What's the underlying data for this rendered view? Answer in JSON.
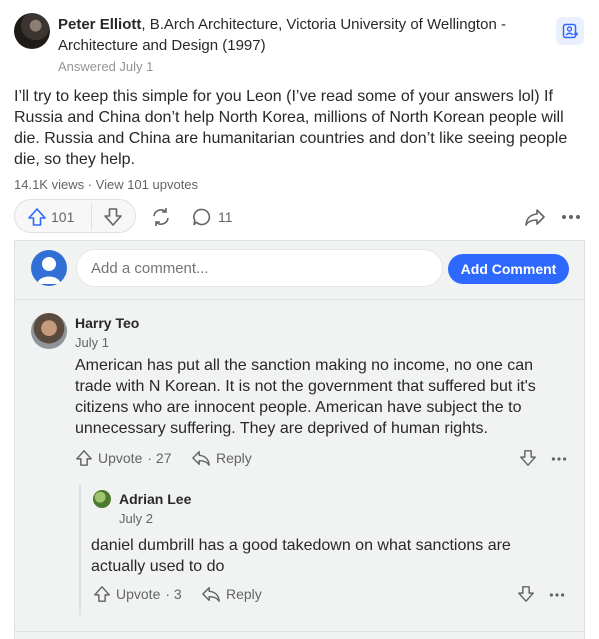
{
  "answer": {
    "author_name": "Peter Elliott",
    "author_credential": ", B.Arch Architecture, Victoria University of Wellington - Architecture and Design (1997)",
    "answered": "Answered July 1",
    "text": "I’ll try to keep this simple for you Leon (I’ve read some of your answers lol) If Russia and China don’t help North Korea, millions of North Korean people will die. Russia and China are humanitarian countries and don’t like seeing people die, so they help.",
    "meta": "14.1K views · View 101 upvotes",
    "upvotes": "101",
    "comments": "11"
  },
  "add_comment": {
    "placeholder": "Add a comment...",
    "button_label": "Add Comment"
  },
  "comments": [
    {
      "author": "Harry Teo",
      "date": "July 1",
      "text": "American has put all the sanction making no income, no one can trade with N Korean. It is not the government that suffered but it's citizens who are innocent people. American have subject the to unnecessary suffering. They are deprived of human rights.",
      "upvote_label": "Upvote",
      "upvote_count": "· 27",
      "reply_label": "Reply"
    },
    {
      "author": "Adrian Lee",
      "date": "July 2",
      "text": "daniel dumbrill has a good takedown on what sanctions are actually used to do",
      "upvote_label": "Upvote",
      "upvote_count": "· 3",
      "reply_label": "Reply"
    }
  ],
  "colors": {
    "accent": "#2e69ff",
    "text": "#282829",
    "muted": "#636466",
    "panel": "#f1f2f2"
  },
  "icons": [
    "author-avatar",
    "follow-icon",
    "upvote-arrow-icon",
    "downvote-arrow-icon",
    "reshare-icon",
    "comment-bubble-icon",
    "share-arrow-icon",
    "more-dots-icon",
    "user-avatar",
    "reply-arrow-icon"
  ]
}
